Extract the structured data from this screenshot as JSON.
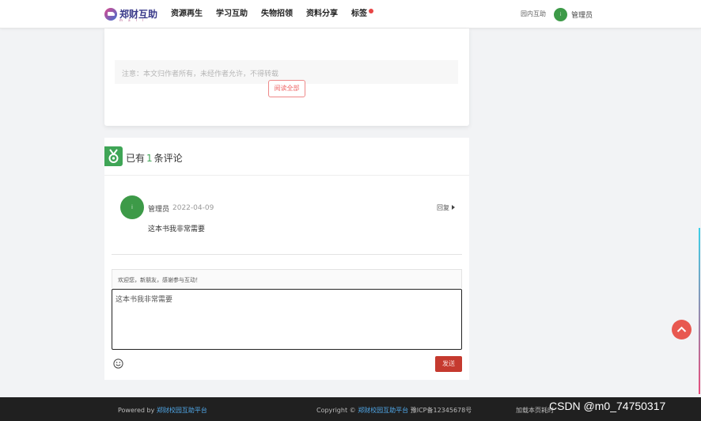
{
  "header": {
    "logo_text": "郑财互助",
    "logo_sub": "m a l l",
    "nav": [
      {
        "label": "资源再生"
      },
      {
        "label": "学习互助"
      },
      {
        "label": "失物招领"
      },
      {
        "label": "资料分享"
      },
      {
        "label": "标签"
      }
    ],
    "right_link": "园内互助",
    "user_name": "管理员",
    "avatar_text": "i"
  },
  "article": {
    "notice": "注意：本文归作者所有，未经作者允许，不得转载",
    "read_all": "阅读全部"
  },
  "comments": {
    "title_prefix": "已有",
    "count": "1",
    "title_suffix": "条评论",
    "items": [
      {
        "user": "管理员",
        "date": "2022-04-09",
        "text": "这本书我非常需要",
        "reply_label": "回复",
        "avatar_text": "i"
      }
    ],
    "greeting": "欢迎您，新朋友，感谢参与互动！",
    "input_value": "这本书我非常需要",
    "send_label": "发送"
  },
  "footer": {
    "powered_prefix": "Powered by",
    "powered_link": "郑财校园互助平台",
    "copyright_prefix": "Copyright ©",
    "copyright_link": "郑财校园互助平台",
    "icp": "豫ICP备12345678号",
    "load_time": "加载本页耗时"
  },
  "watermark": "CSDN @m0_74750317",
  "colors": {
    "accent_green": "#3fa556",
    "send_red": "#c53a2f",
    "to_top_red": "#e85850",
    "footer_bg": "#202020",
    "link_blue": "#4fa7e8"
  }
}
